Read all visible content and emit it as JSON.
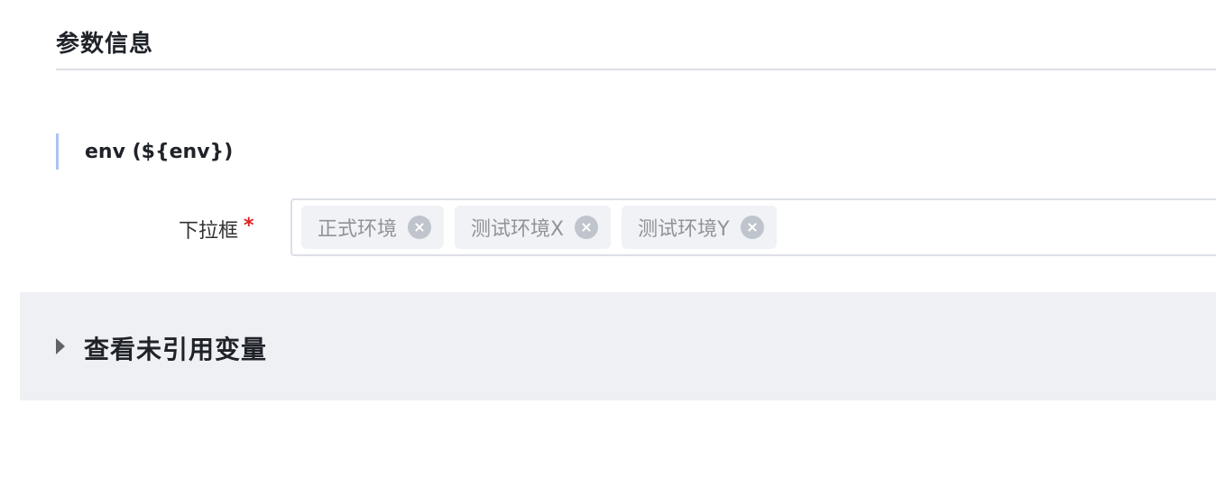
{
  "section": {
    "title": "参数信息"
  },
  "param": {
    "name": "env (${env})"
  },
  "form": {
    "label": "下拉框",
    "required_mark": "*",
    "tags": [
      {
        "label": "正式环境"
      },
      {
        "label": "测试环境X"
      },
      {
        "label": "测试环境Y"
      }
    ]
  },
  "collapse": {
    "title": "查看未引用变量",
    "expanded": false
  },
  "icons": {
    "tag_remove": "close-circle-icon",
    "collapse": "caret-right-icon"
  },
  "colors": {
    "accent_bar": "#a8c5f2",
    "required": "#e02020",
    "tag_bg": "#f0f2f5",
    "panel_bg": "#eff0f3"
  }
}
